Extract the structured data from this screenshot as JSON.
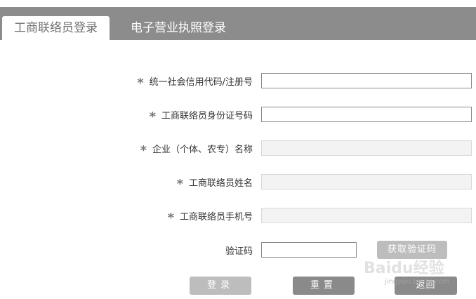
{
  "tabs": {
    "active": "工商联络员登录",
    "inactive": "电子营业执照登录"
  },
  "form": {
    "required_mark": "*",
    "credit_code_label": "统一社会信用代码/注册号",
    "id_number_label": "工商联络员身份证号码",
    "company_name_label": "企业（个体、农专）名称",
    "liaison_name_label": "工商联络员姓名",
    "phone_label": "工商联络员手机号",
    "captcha_label": "验证码"
  },
  "buttons": {
    "get_code": "获取验证码",
    "login": "登录",
    "reset": "重置",
    "back": "返回"
  },
  "watermark": {
    "logo": "Baidu经验",
    "url": "jingyan.baidu.com"
  }
}
